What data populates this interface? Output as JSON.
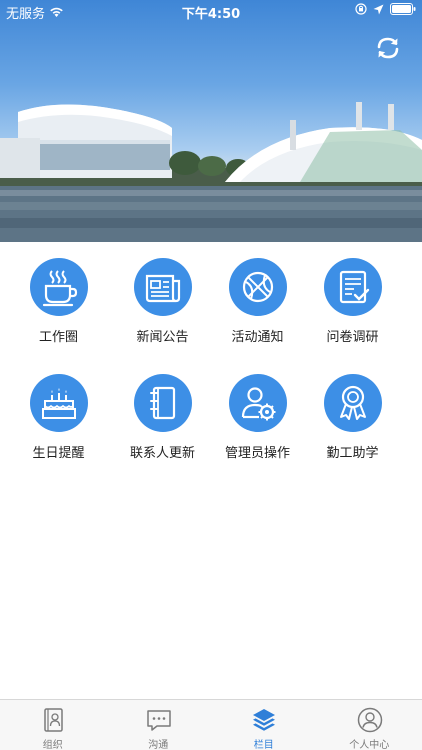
{
  "status_bar": {
    "carrier": "无服务",
    "time": "下午4:50"
  },
  "grid": {
    "items": [
      {
        "label": "工作圈",
        "icon": "coffee-cup-icon"
      },
      {
        "label": "新闻公告",
        "icon": "newspaper-icon"
      },
      {
        "label": "活动通知",
        "icon": "basketball-icon"
      },
      {
        "label": "问卷调研",
        "icon": "checklist-icon"
      },
      {
        "label": "生日提醒",
        "icon": "birthday-cake-icon"
      },
      {
        "label": "联系人更新",
        "icon": "address-book-icon"
      },
      {
        "label": "管理员操作",
        "icon": "admin-gear-icon"
      },
      {
        "label": "勤工助学",
        "icon": "award-ribbon-icon"
      }
    ]
  },
  "tab_bar": {
    "tabs": [
      {
        "label": "组织",
        "icon": "contacts-book-icon",
        "active": false
      },
      {
        "label": "沟通",
        "icon": "chat-bubble-icon",
        "active": false
      },
      {
        "label": "栏目",
        "icon": "layers-icon",
        "active": true
      },
      {
        "label": "个人中心",
        "icon": "user-circle-icon",
        "active": false
      }
    ]
  },
  "colors": {
    "accent": "#3d8fe6",
    "active_tab": "#2f7fd8",
    "inactive_tab": "#7a7a7a"
  }
}
